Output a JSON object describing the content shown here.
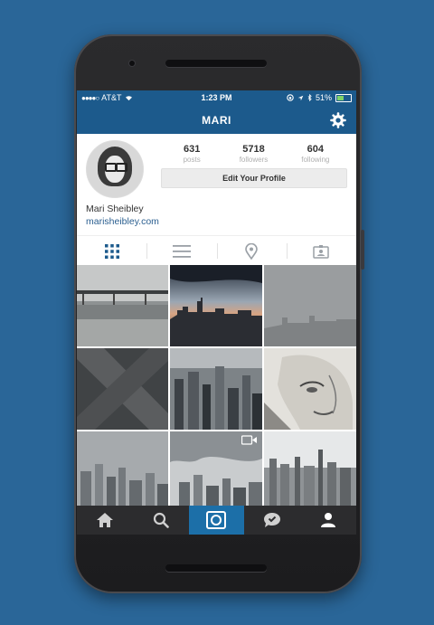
{
  "status_bar": {
    "carrier": "AT&T",
    "time": "1:23 PM",
    "battery": "51%",
    "battery_fill": 0.51
  },
  "navbar": {
    "title": "MARI",
    "settings_icon": "gear-icon"
  },
  "profile": {
    "stats": [
      {
        "value": "631",
        "label": "posts"
      },
      {
        "value": "5718",
        "label": "followers"
      },
      {
        "value": "604",
        "label": "following"
      }
    ],
    "edit_button": "Edit Your Profile",
    "name": "Mari Sheibley",
    "website": "marisheibley.com"
  },
  "view_tabs": [
    {
      "icon": "grid-icon",
      "active": true
    },
    {
      "icon": "list-icon",
      "active": false
    },
    {
      "icon": "location-pin-icon",
      "active": false
    },
    {
      "icon": "tagged-photo-icon",
      "active": false
    }
  ],
  "photos": [
    {
      "subject": "pavilion by the water"
    },
    {
      "subject": "city skyline at dusk"
    },
    {
      "subject": "foggy skyline"
    },
    {
      "subject": "abstract x pattern"
    },
    {
      "subject": "aerial city view"
    },
    {
      "subject": "pencil drawing of face"
    },
    {
      "subject": "grey city towers"
    },
    {
      "subject": "city under clouds",
      "video": true
    },
    {
      "subject": "city panorama"
    }
  ],
  "bottom_nav": [
    {
      "icon": "home-icon",
      "active": false
    },
    {
      "icon": "search-icon",
      "active": false
    },
    {
      "icon": "camera-icon",
      "active": true
    },
    {
      "icon": "activity-bubble-icon",
      "active": false
    },
    {
      "icon": "profile-icon",
      "active": false
    }
  ],
  "colors": {
    "background": "#2a6698",
    "navbar": "#1c5a8c",
    "link": "#2b5f90",
    "tabbar": "#2c2c2e",
    "tabbar_active": "#1c6fa8"
  }
}
